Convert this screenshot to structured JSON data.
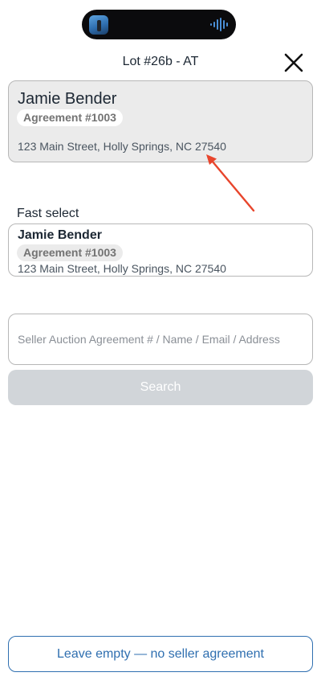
{
  "header": {
    "title": "Lot #26b - AT",
    "close_icon": "close-icon"
  },
  "selected": {
    "name": "Jamie Bender",
    "agreement": "Agreement #1003",
    "address": "123 Main Street, Holly Springs, NC 27540"
  },
  "fast_select": {
    "label": "Fast select",
    "items": [
      {
        "name": "Jamie Bender",
        "agreement": "Agreement #1003",
        "address": "123 Main Street, Holly Springs, NC 27540"
      }
    ]
  },
  "search": {
    "placeholder": "Seller Auction Agreement # / Name / Email / Address",
    "value": "",
    "button_label": "Search"
  },
  "footer": {
    "leave_empty_label": "Leave empty — no seller agreement"
  },
  "colors": {
    "accent": "#2f6fb0",
    "annotation_arrow": "#e8452c",
    "card_selected_bg": "#ebebeb",
    "disabled_button": "#d1d5d9"
  }
}
